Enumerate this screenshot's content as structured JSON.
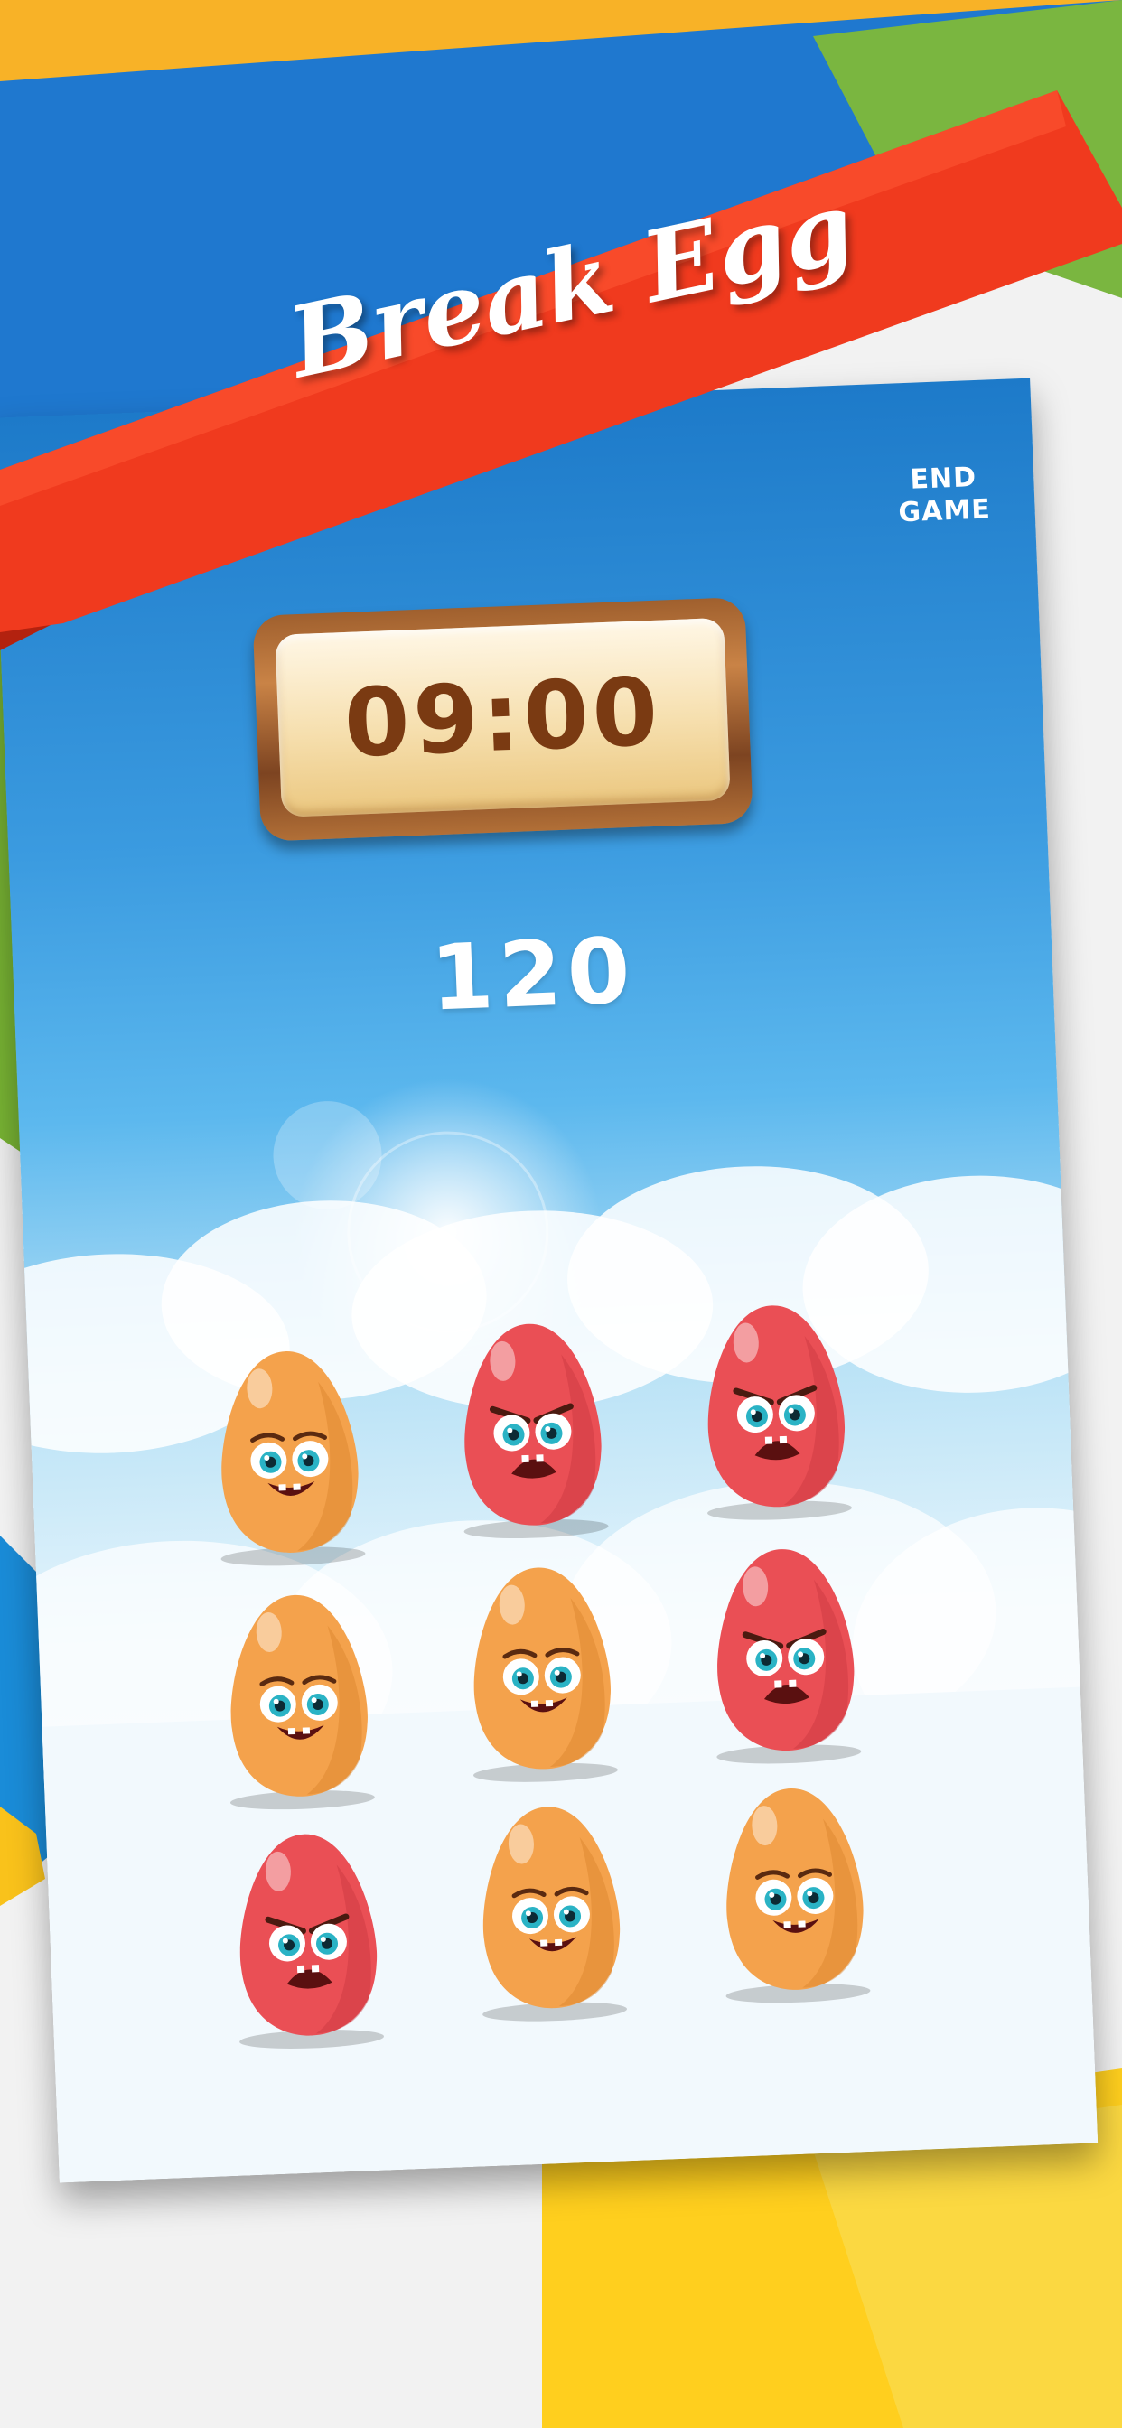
{
  "app": {
    "title": "Break Egg"
  },
  "controls": {
    "end_game_line1": "END",
    "end_game_line2": "GAME"
  },
  "timer": {
    "value": "09:00"
  },
  "score": {
    "value": "120"
  },
  "colors": {
    "ribbon": "#f03a1e",
    "sky_top": "#1d7ac9",
    "timer_text": "#7a3a12",
    "egg_happy": "#f4a24c",
    "egg_angry": "#ea4f55"
  },
  "eggs": [
    {
      "mood": "happy"
    },
    {
      "mood": "angry"
    },
    {
      "mood": "angry"
    },
    {
      "mood": "happy"
    },
    {
      "mood": "happy"
    },
    {
      "mood": "angry"
    },
    {
      "mood": "angry"
    },
    {
      "mood": "happy"
    },
    {
      "mood": "happy"
    }
  ]
}
